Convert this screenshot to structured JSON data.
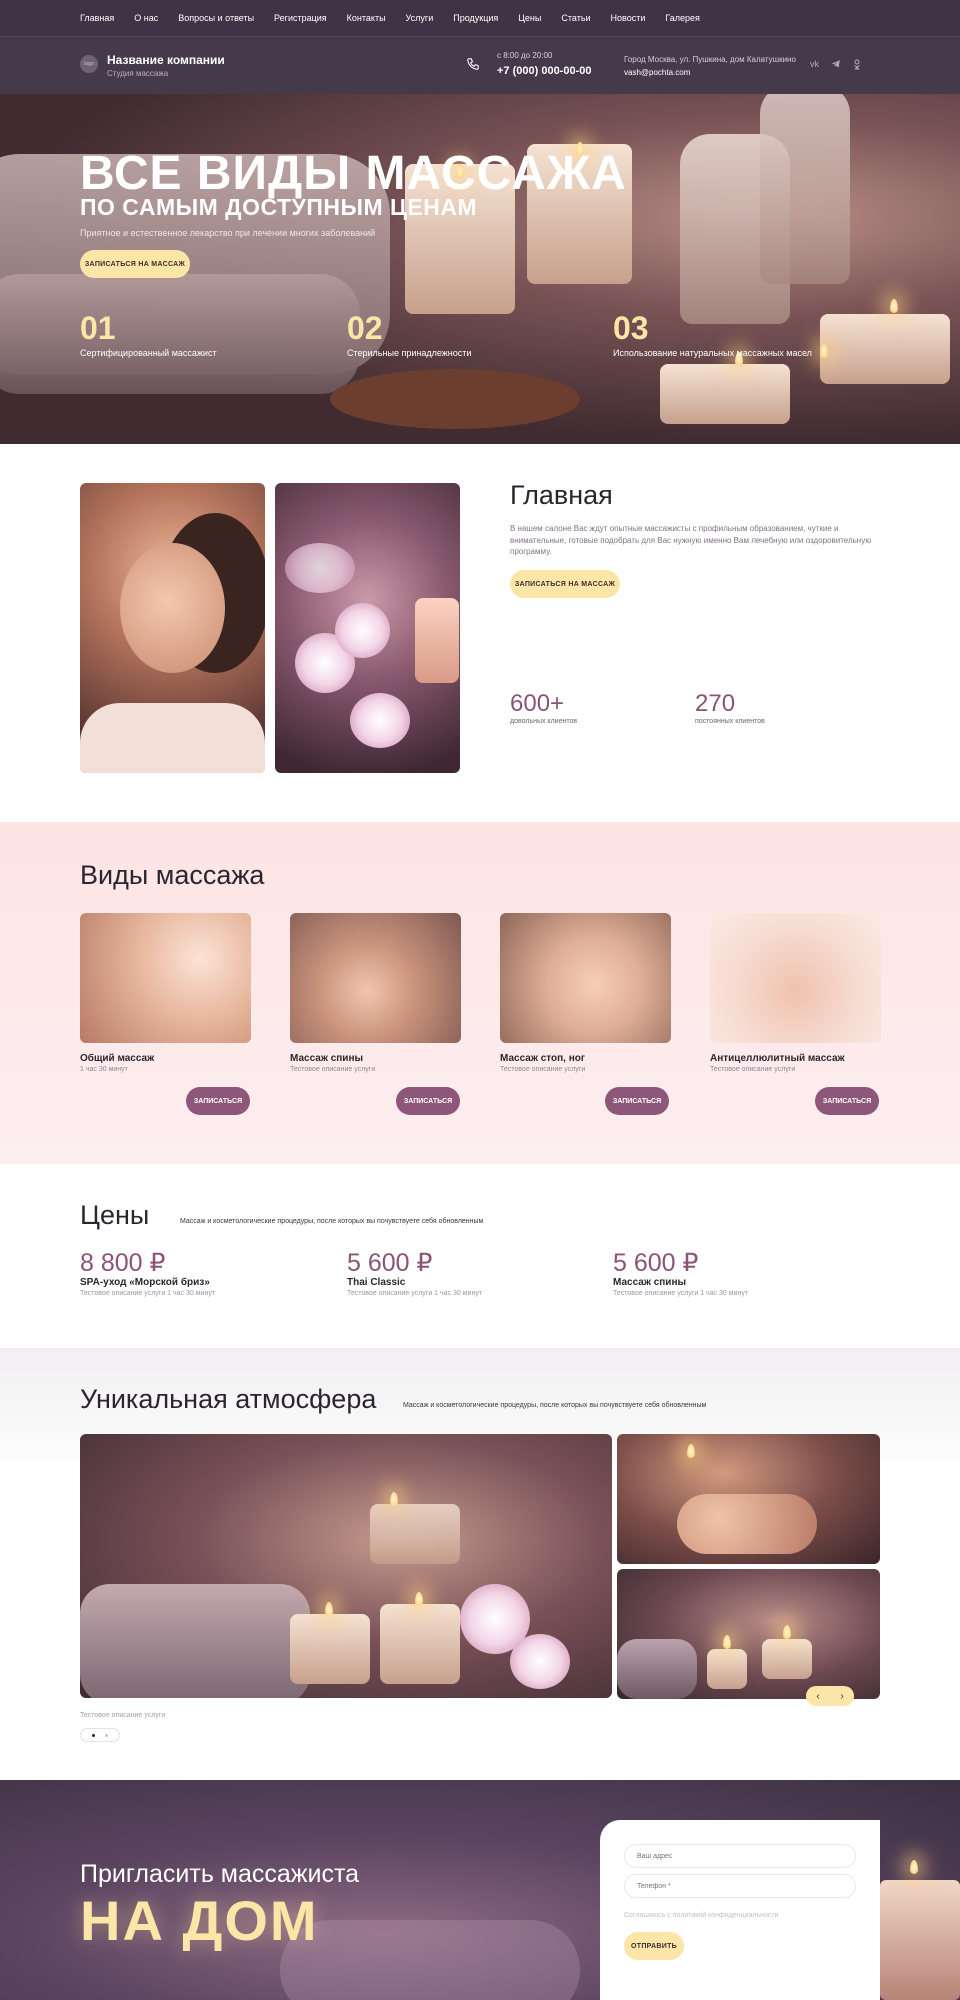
{
  "nav": [
    "Главная",
    "О нас",
    "Вопросы и ответы",
    "Регистрация",
    "Контакты",
    "Услуги",
    "Продукция",
    "Цены",
    "Статьи",
    "Новости",
    "Галерея"
  ],
  "header": {
    "logo_text": "logo",
    "company_name": "Название компании",
    "company_sub": "Студия массажа",
    "hours": "с 8:00 до 20:00",
    "phone": "+7 (000) 000-00-00",
    "address": "Город Москва, ул. Пушкина, дом Калатушкино",
    "email": "vash@pochta.com",
    "socials": [
      "vk-icon",
      "telegram-icon",
      "ok-icon"
    ]
  },
  "hero": {
    "title": "ВСЕ ВИДЫ МАССАЖА",
    "subtitle": "ПО САМЫМ ДОСТУПНЫМ ЦЕНАМ",
    "desc": "Приятное и естественное лекарство при лечении многих заболеваний",
    "button": "ЗАПИСАТЬСЯ НА МАССАЖ",
    "stats": [
      {
        "num": "01",
        "text": "Сертифицированный массажист"
      },
      {
        "num": "02",
        "text": "Стерильные принадлежности"
      },
      {
        "num": "03",
        "text": "Использование натуральных массажных масел"
      }
    ]
  },
  "about": {
    "title": "Главная",
    "text": "В нашем салоне Вас ждут опытные массажисты с профильным образованием, чуткие и внимательные, готовые подобрать для Вас нужную именно Вам лечебную или оздоровительную программу.",
    "button": "ЗАПИСАТЬСЯ НА МАССАЖ",
    "counters": [
      {
        "num": "600+",
        "caption": "довольных клиентов"
      },
      {
        "num": "270",
        "caption": "постоянных клиентов"
      }
    ]
  },
  "types": {
    "title": "Виды массажа",
    "cards": [
      {
        "title": "Общий массаж",
        "desc": "1 час 30 минут",
        "button": "ЗАПИСАТЬСЯ"
      },
      {
        "title": "Массаж спины",
        "desc": "Тестовое описание услуги",
        "button": "ЗАПИСАТЬСЯ"
      },
      {
        "title": "Массаж стоп, ног",
        "desc": "Тестовое описание услуги",
        "button": "ЗАПИСАТЬСЯ"
      },
      {
        "title": "Антицеллюлитный массаж",
        "desc": "Тестовое описание услуги",
        "button": "ЗАПИСАТЬСЯ"
      }
    ]
  },
  "prices": {
    "title": "Цены",
    "subtitle": "Массаж и косметологические процедуры, после которых вы почувствуете себя обновленным",
    "items": [
      {
        "price": "8 800 ₽",
        "name": "SPA-уход «Морской бриз»",
        "desc": "Тестовое описание услуги 1 час 30 минут"
      },
      {
        "price": "5 600 ₽",
        "name": "Thai Classic",
        "desc": "Тестовое описание услуги 1 час 30 минут"
      },
      {
        "price": "5 600 ₽",
        "name": "Массаж спины",
        "desc": "Тестовое описание услуги 1 час 30 минут"
      }
    ]
  },
  "atmosphere": {
    "title": "Уникальная атмосфера",
    "subtitle": "Массаж и косметологические процедуры, после которых вы почувствуете себя обновленным",
    "caption": "Тестовое описание услуги",
    "prev": "‹",
    "next": "›"
  },
  "cta": {
    "line1": "Пригласить массажиста",
    "line2": "НА ДОМ",
    "address_placeholder": "Ваш адрес",
    "phone_placeholder": "Телефон *",
    "consent": "Соглашаюсь с политикой конфиденциальности",
    "button": "ОТПРАВИТЬ"
  },
  "colors": {
    "accent": "#8e5779",
    "button_yellow": "#fbe6a7",
    "header_bg": "#453a4c",
    "pink_bg": "#fde4e4"
  }
}
